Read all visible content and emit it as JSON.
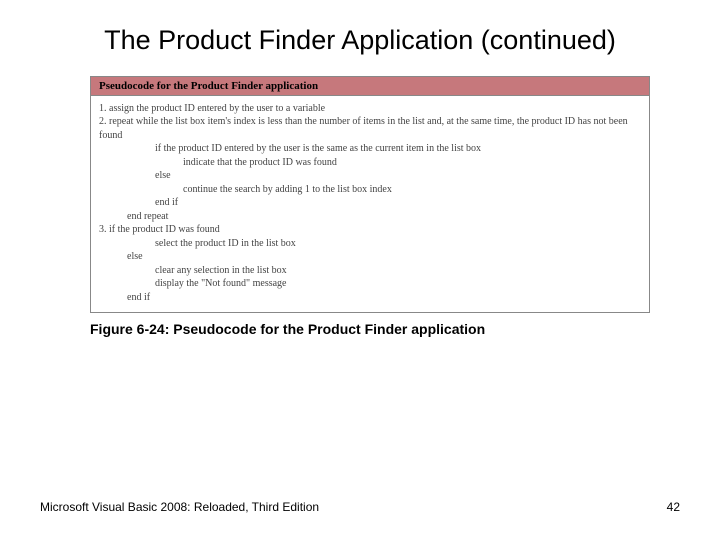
{
  "title": "The Product Finder Application (continued)",
  "figure": {
    "header": "Pseudocode for the Product Finder application",
    "lines": [
      {
        "indent": 0,
        "text": "1. assign the product ID entered by the user to a variable"
      },
      {
        "indent": 0,
        "text": "2. repeat while the list box item's index is less than the number of items in the list and, at the same time, the product ID has not been found"
      },
      {
        "indent": 2,
        "text": "if the product ID entered by the user is the same as the current item in the list box"
      },
      {
        "indent": 3,
        "text": "indicate that the product ID was found"
      },
      {
        "indent": 2,
        "text": "else"
      },
      {
        "indent": 3,
        "text": "continue the search by adding 1 to the list box index"
      },
      {
        "indent": 2,
        "text": "end if"
      },
      {
        "indent": 1,
        "text": "end repeat"
      },
      {
        "indent": 0,
        "text": "3. if the product ID was found"
      },
      {
        "indent": 2,
        "text": "select the product ID in the list box"
      },
      {
        "indent": 1,
        "text": "else"
      },
      {
        "indent": 2,
        "text": "clear any selection in the list box"
      },
      {
        "indent": 2,
        "text": "display the \"Not found\" message"
      },
      {
        "indent": 1,
        "text": "end if"
      }
    ]
  },
  "caption": "Figure 6-24: Pseudocode for the Product Finder application",
  "footer_left": "Microsoft Visual Basic 2008: Reloaded, Third Edition",
  "footer_right": "42"
}
